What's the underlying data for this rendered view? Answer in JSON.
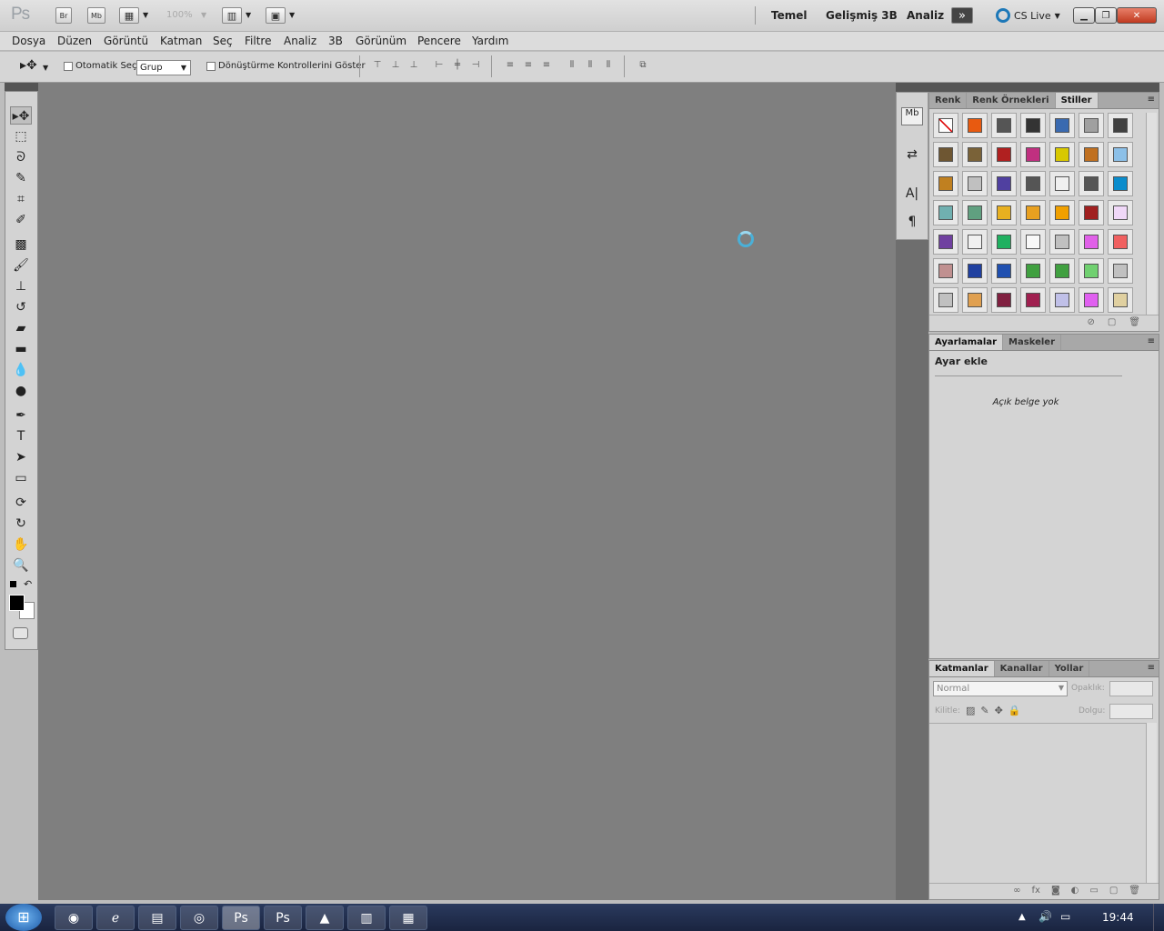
{
  "app": {
    "logo": "Ps",
    "zoom": "100%",
    "bridge_label": "Br",
    "mini_bridge_label": "Mb"
  },
  "workspaces": [
    "Temel",
    "Gelişmiş 3B",
    "Analiz"
  ],
  "cslive": "CS Live",
  "menu": [
    "Dosya",
    "Düzen",
    "Görüntü",
    "Katman",
    "Seç",
    "Filtre",
    "Analiz",
    "3B",
    "Görünüm",
    "Pencere",
    "Yardım"
  ],
  "options": {
    "auto_select_label": "Otomatik Seç:",
    "auto_select_value": "Grup",
    "transform_label": "Dönüştürme Kontrollerini Göster"
  },
  "styles_panel": {
    "tabs": [
      "Renk",
      "Renk Örnekleri",
      "Stiller"
    ],
    "active": "Stiller",
    "swatches": [
      "#ffffff",
      "#e85a10",
      "#555555",
      "#333333",
      "#3a6ab0",
      "#a0a0a0",
      "#404040",
      "#6e5632",
      "#7a6238",
      "#b02020",
      "#c03080",
      "#d8c800",
      "#c07020",
      "#8cc0e8",
      "#c08020",
      "#c0c0c0",
      "#5040a0",
      "#555555",
      "#f0f0f0",
      "#555555",
      "#0a8ccc",
      "#70b0b0",
      "#60a080",
      "#e8b020",
      "#e8a020",
      "#f0a000",
      "#a02020",
      "#f0d8f8",
      "#7040a0",
      "#f0f0f0",
      "#20b060",
      "#f8f8f8",
      "#c0c0c0",
      "#e060e8",
      "#f06060",
      "#c09090",
      "#2040a0",
      "#2050b0",
      "#40a040",
      "#40a040",
      "#70d070",
      "#c0c0c0",
      "#c0c0c0",
      "#e0a050",
      "#802040",
      "#a02050",
      "#c0c0e8",
      "#e060f0",
      "#e0d0a0"
    ]
  },
  "adjustments_panel": {
    "tabs": [
      "Ayarlamalar",
      "Maskeler"
    ],
    "title": "Ayar ekle",
    "message": "Açık belge yok"
  },
  "layers_panel": {
    "tabs": [
      "Katmanlar",
      "Kanallar",
      "Yollar"
    ],
    "blend": "Normal",
    "opacity_label": "Opaklık:",
    "lock_label": "Kilitle:",
    "fill_label": "Dolgu:"
  },
  "taskbar": {
    "time": "19:44"
  }
}
